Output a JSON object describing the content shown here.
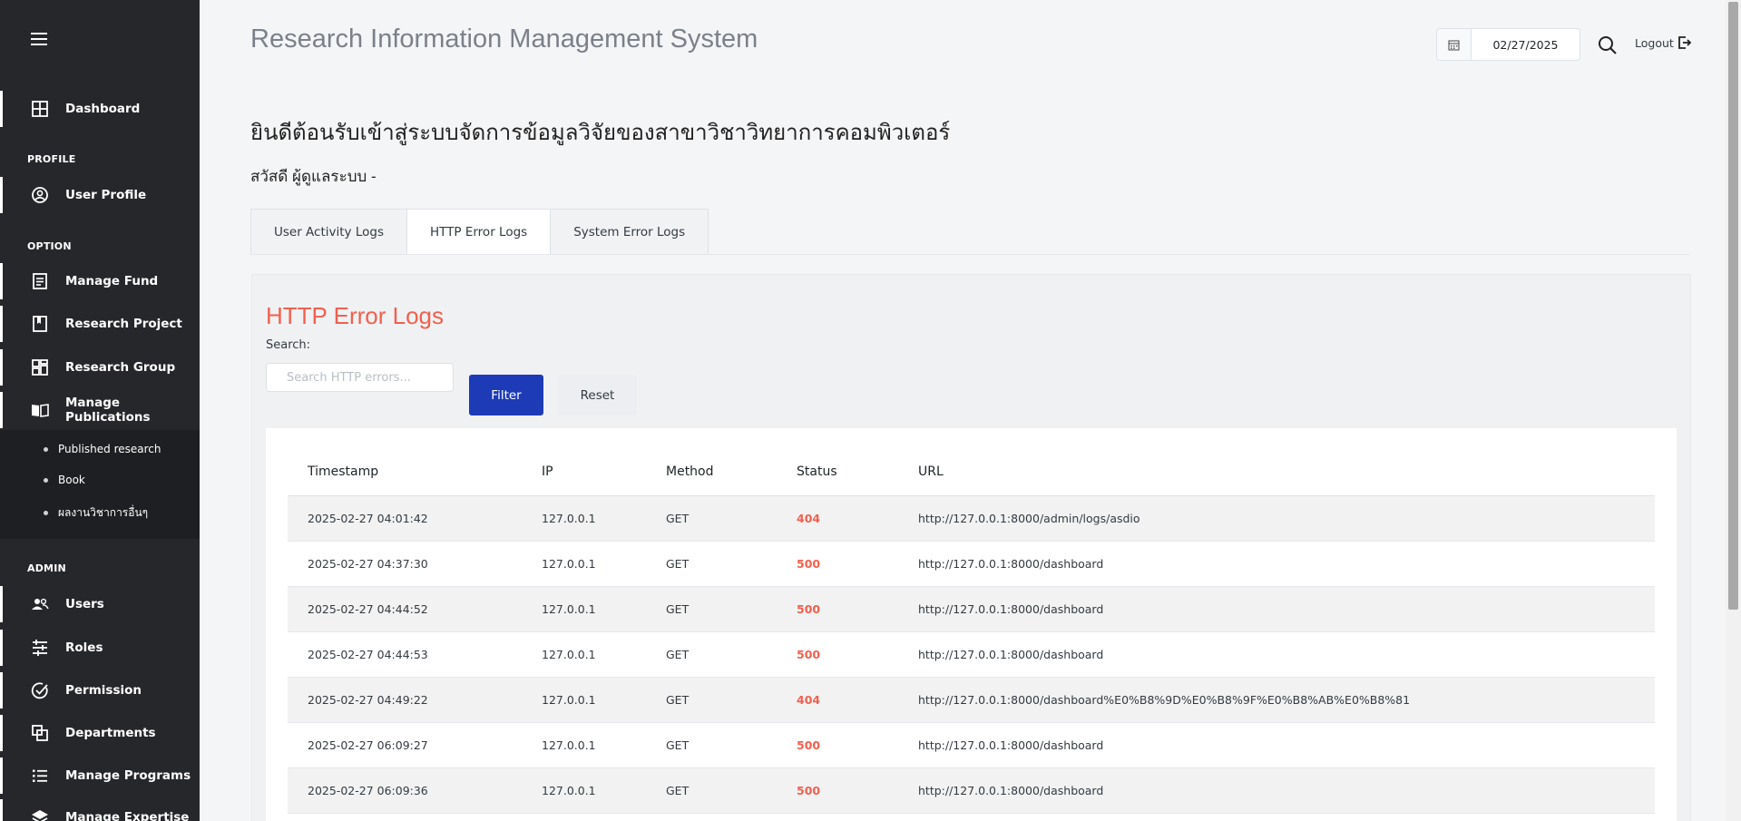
{
  "sidebar": {
    "menu_icon": "hamburger-icon",
    "dashboard": "Dashboard",
    "profile_section": "PROFILE",
    "user_profile": "User Profile",
    "option_section": "OPTION",
    "manage_fund": "Manage Fund",
    "research_project": "Research Project",
    "research_group": "Research Group",
    "manage_publications": "Manage Publications",
    "publications_sub": [
      "Published research",
      "Book",
      "ผลงานวิชาการอื่นๆ"
    ],
    "admin_section": "ADMIN",
    "users": "Users",
    "roles": "Roles",
    "permission": "Permission",
    "departments": "Departments",
    "manage_programs": "Manage Programs",
    "manage_expertise": "Manage Expertise"
  },
  "header": {
    "title": "Research Information Management System",
    "date": "02/27/2025",
    "logout": "Logout"
  },
  "welcome": "ยินดีต้อนรับเข้าสู่ระบบจัดการข้อมูลวิจัยของสาขาวิชาวิทยาการคอมพิวเตอร์",
  "greeting": "สวัสดี ผู้ดูแลระบบ -",
  "tabs": [
    "User Activity Logs",
    "HTTP Error Logs",
    "System Error Logs"
  ],
  "panel": {
    "title": "HTTP Error Logs",
    "search_label": "Search:",
    "search_placeholder": "Search HTTP errors...",
    "filter": "Filter",
    "reset": "Reset"
  },
  "table": {
    "columns": [
      "Timestamp",
      "IP",
      "Method",
      "Status",
      "URL"
    ],
    "rows": [
      [
        "2025-02-27 04:01:42",
        "127.0.0.1",
        "GET",
        "404",
        "http://127.0.0.1:8000/admin/logs/asdio"
      ],
      [
        "2025-02-27 04:37:30",
        "127.0.0.1",
        "GET",
        "500",
        "http://127.0.0.1:8000/dashboard"
      ],
      [
        "2025-02-27 04:44:52",
        "127.0.0.1",
        "GET",
        "500",
        "http://127.0.0.1:8000/dashboard"
      ],
      [
        "2025-02-27 04:44:53",
        "127.0.0.1",
        "GET",
        "500",
        "http://127.0.0.1:8000/dashboard"
      ],
      [
        "2025-02-27 04:49:22",
        "127.0.0.1",
        "GET",
        "404",
        "http://127.0.0.1:8000/dashboard%E0%B8%9D%E0%B8%9F%E0%B8%AB%E0%B8%81"
      ],
      [
        "2025-02-27 06:09:27",
        "127.0.0.1",
        "GET",
        "500",
        "http://127.0.0.1:8000/dashboard"
      ],
      [
        "2025-02-27 06:09:36",
        "127.0.0.1",
        "GET",
        "500",
        "http://127.0.0.1:8000/dashboard"
      ]
    ]
  },
  "colors": {
    "sidebar_bg": "#26272b",
    "accent_red": "#f2604f",
    "primary_blue": "#1d3ab7"
  }
}
